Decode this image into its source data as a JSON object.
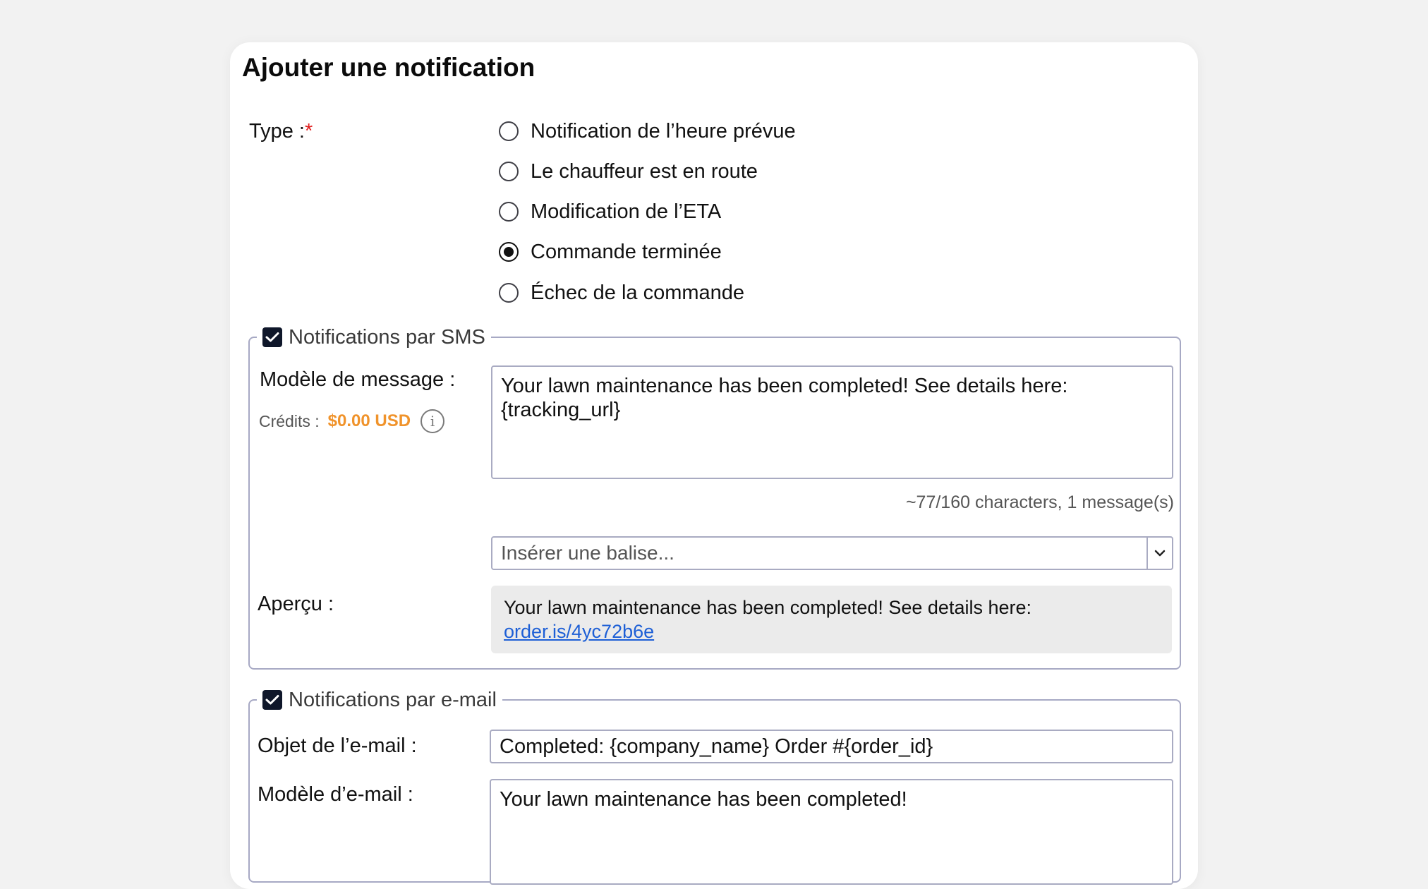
{
  "form": {
    "title": "Ajouter une notification",
    "type_label": "Type :",
    "required_mark": "*",
    "type_options": [
      {
        "label": "Notification de l’heure prévue",
        "checked": false
      },
      {
        "label": "Le chauffeur est en route",
        "checked": false
      },
      {
        "label": "Modification de l’ETA",
        "checked": false
      },
      {
        "label": "Commande terminée",
        "checked": true
      },
      {
        "label": "Échec de la commande",
        "checked": false
      }
    ]
  },
  "sms": {
    "enabled": true,
    "legend": "Notifications par SMS",
    "template_label": "Modèle de message :",
    "credits_label": "Crédits :",
    "credits_value": "$0.00 USD",
    "template_value": "Your lawn maintenance has been completed! See details here:\n{tracking_url}",
    "counter": "~77/160 characters, 1 message(s)",
    "tag_select_placeholder": "Insérer une balise...",
    "preview_label": "Aperçu :",
    "preview_text": "Your lawn maintenance has been completed! See details here:",
    "preview_link": "order.is/4yc72b6e"
  },
  "email": {
    "enabled": true,
    "legend": "Notifications par e-mail",
    "subject_label": "Objet de l’e-mail :",
    "subject_value": "Completed: {company_name} Order #{order_id}",
    "template_label": "Modèle d’e-mail :",
    "template_value": "Your lawn maintenance has been completed!"
  },
  "colors": {
    "required": "#e11d1d",
    "credits": "#f0932b",
    "link": "#1d5fd6",
    "checkbox": "#0f172a"
  }
}
